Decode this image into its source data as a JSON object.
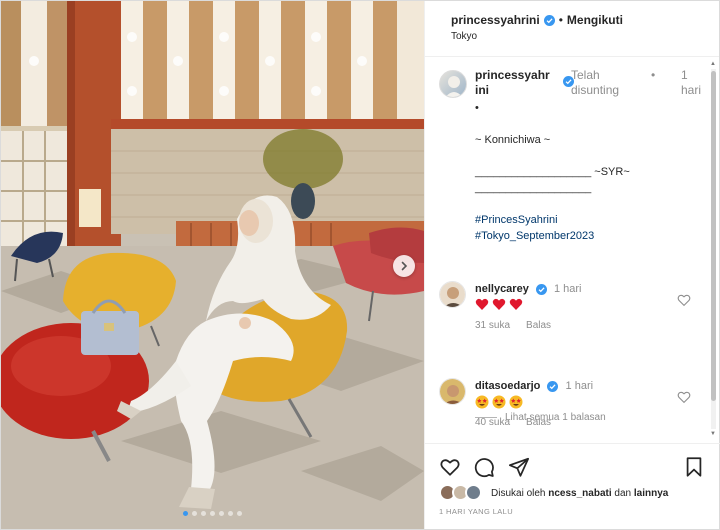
{
  "header": {
    "username": "princessyahrini",
    "separator": "•",
    "follow_label": "Mengikuti",
    "location": "Tokyo"
  },
  "caption": {
    "username": "princessyahrini",
    "edited_label": "Telah disunting",
    "separator": "•",
    "time": "1 hari",
    "lines": [
      "•",
      "",
      "~ Konnichiwa ~",
      "",
      "___________________ ~SYR~",
      "___________________",
      "",
      "#PrincesSyahrini",
      "#Tokyo_September2023"
    ]
  },
  "comments": [
    {
      "username": "nellycarey",
      "time": "1 hari",
      "emoji": [
        "red-heart",
        "red-heart",
        "red-heart"
      ],
      "likes": "31 suka",
      "reply_label": "Balas"
    },
    {
      "username": "ditasoedarjo",
      "time": "1 hari",
      "emoji": [
        "star-struck",
        "star-struck",
        "star-struck"
      ],
      "likes": "40 suka",
      "reply_label": "Balas"
    }
  ],
  "view_replies": "Lihat semua 1 balasan",
  "likes": {
    "prefix": "Disukai oleh",
    "user": "ncess_nabati",
    "joiner": "dan",
    "others": "lainnya"
  },
  "post_date": "1 HARI YANG LALU",
  "carousel": {
    "dot_count": 7,
    "active_index": 0
  },
  "icons": [
    "verified-badge-icon",
    "chevron-right-icon",
    "heart-icon",
    "comment-icon",
    "share-icon",
    "bookmark-icon"
  ],
  "colors": {
    "verified": "#3897f0",
    "hashtag": "#00376b",
    "muted": "#8e8e8e",
    "heart_red": "#ed4956"
  }
}
